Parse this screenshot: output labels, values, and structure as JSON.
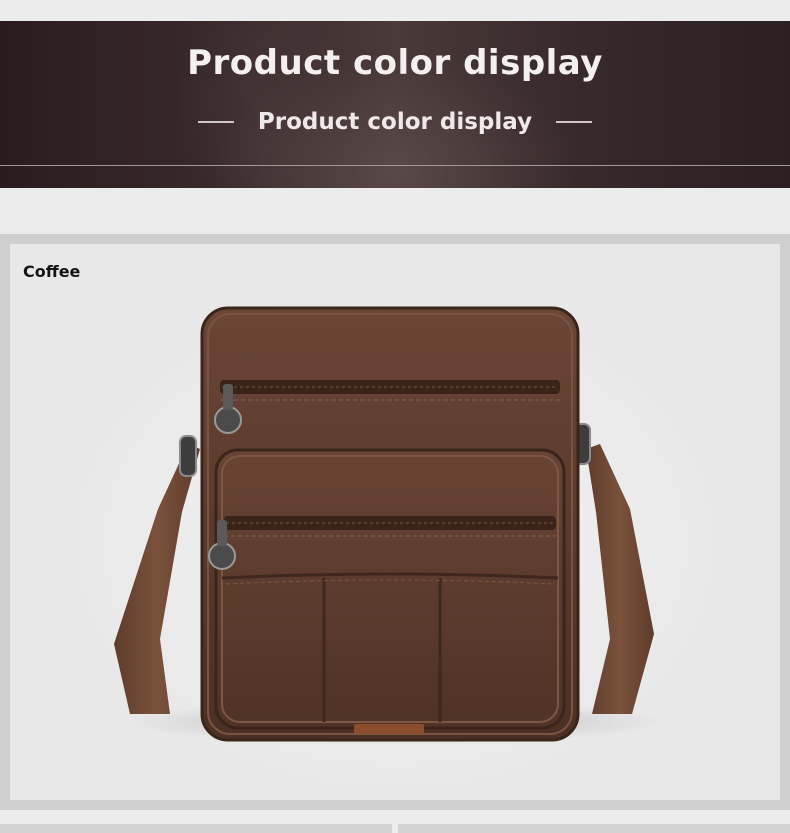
{
  "banner": {
    "title": "Product color display",
    "subtitle": "Product color display"
  },
  "product": {
    "color_name": "Coffee"
  },
  "colors": {
    "banner_bg": "#3a2a2b",
    "leather": "#5a3a2c",
    "strap": "#6e4a36",
    "photo_bg": "#ececec"
  }
}
